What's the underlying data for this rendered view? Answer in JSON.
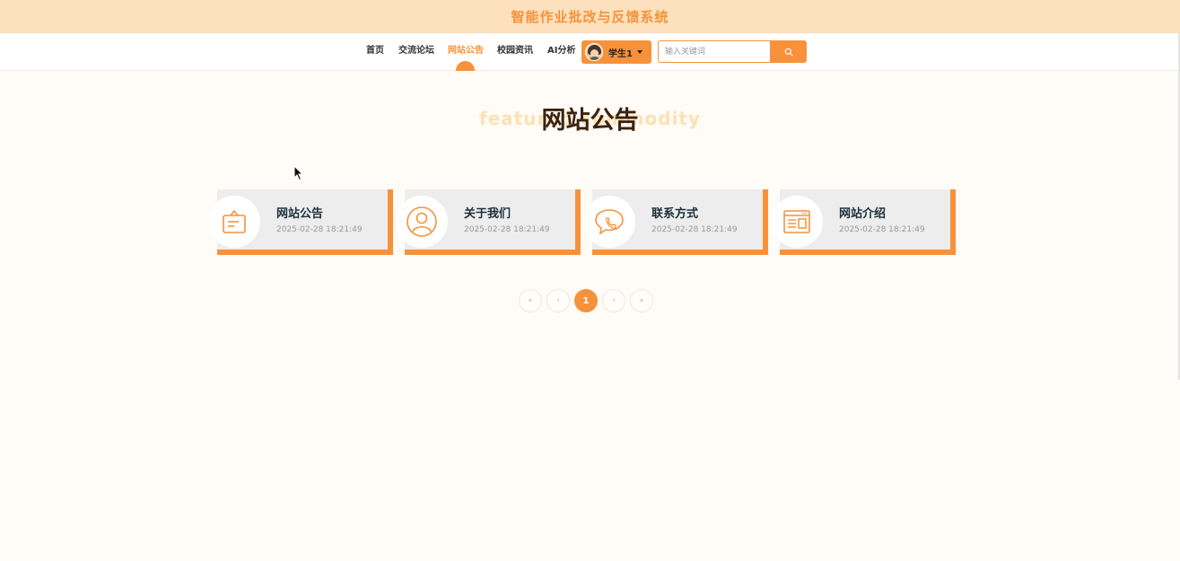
{
  "header": {
    "site_title": "智能作业批改与反馈系统"
  },
  "nav": {
    "items": [
      {
        "label": "首页",
        "active": false
      },
      {
        "label": "交流论坛",
        "active": false
      },
      {
        "label": "网站公告",
        "active": true
      },
      {
        "label": "校园资讯",
        "active": false
      },
      {
        "label": "AI分析",
        "active": false
      }
    ],
    "user": {
      "name": "学生1",
      "avatar": "user-avatar"
    },
    "search": {
      "placeholder": "输入关键词",
      "value": "",
      "button_icon": "search-icon"
    }
  },
  "section": {
    "title": "网站公告",
    "subtitle": "featured commodity"
  },
  "cards": [
    {
      "title": "网站公告",
      "date": "2025-02-28 18:21:49",
      "icon": "notice-board-icon"
    },
    {
      "title": "关于我们",
      "date": "2025-02-28 18:21:49",
      "icon": "user-profile-icon"
    },
    {
      "title": "联系方式",
      "date": "2025-02-28 18:21:49",
      "icon": "chat-phone-icon"
    },
    {
      "title": "网站介绍",
      "date": "2025-02-28 18:21:49",
      "icon": "browser-window-icon"
    }
  ],
  "pagination": {
    "first": "«",
    "prev": "‹",
    "current": "1",
    "next": "›",
    "last": "»"
  },
  "colors": {
    "accent": "#f7923a",
    "topbar_bg": "#fde0bd",
    "page_bg": "#fffbf6",
    "card_bg": "#ededed",
    "title_dark": "#3a230f"
  }
}
